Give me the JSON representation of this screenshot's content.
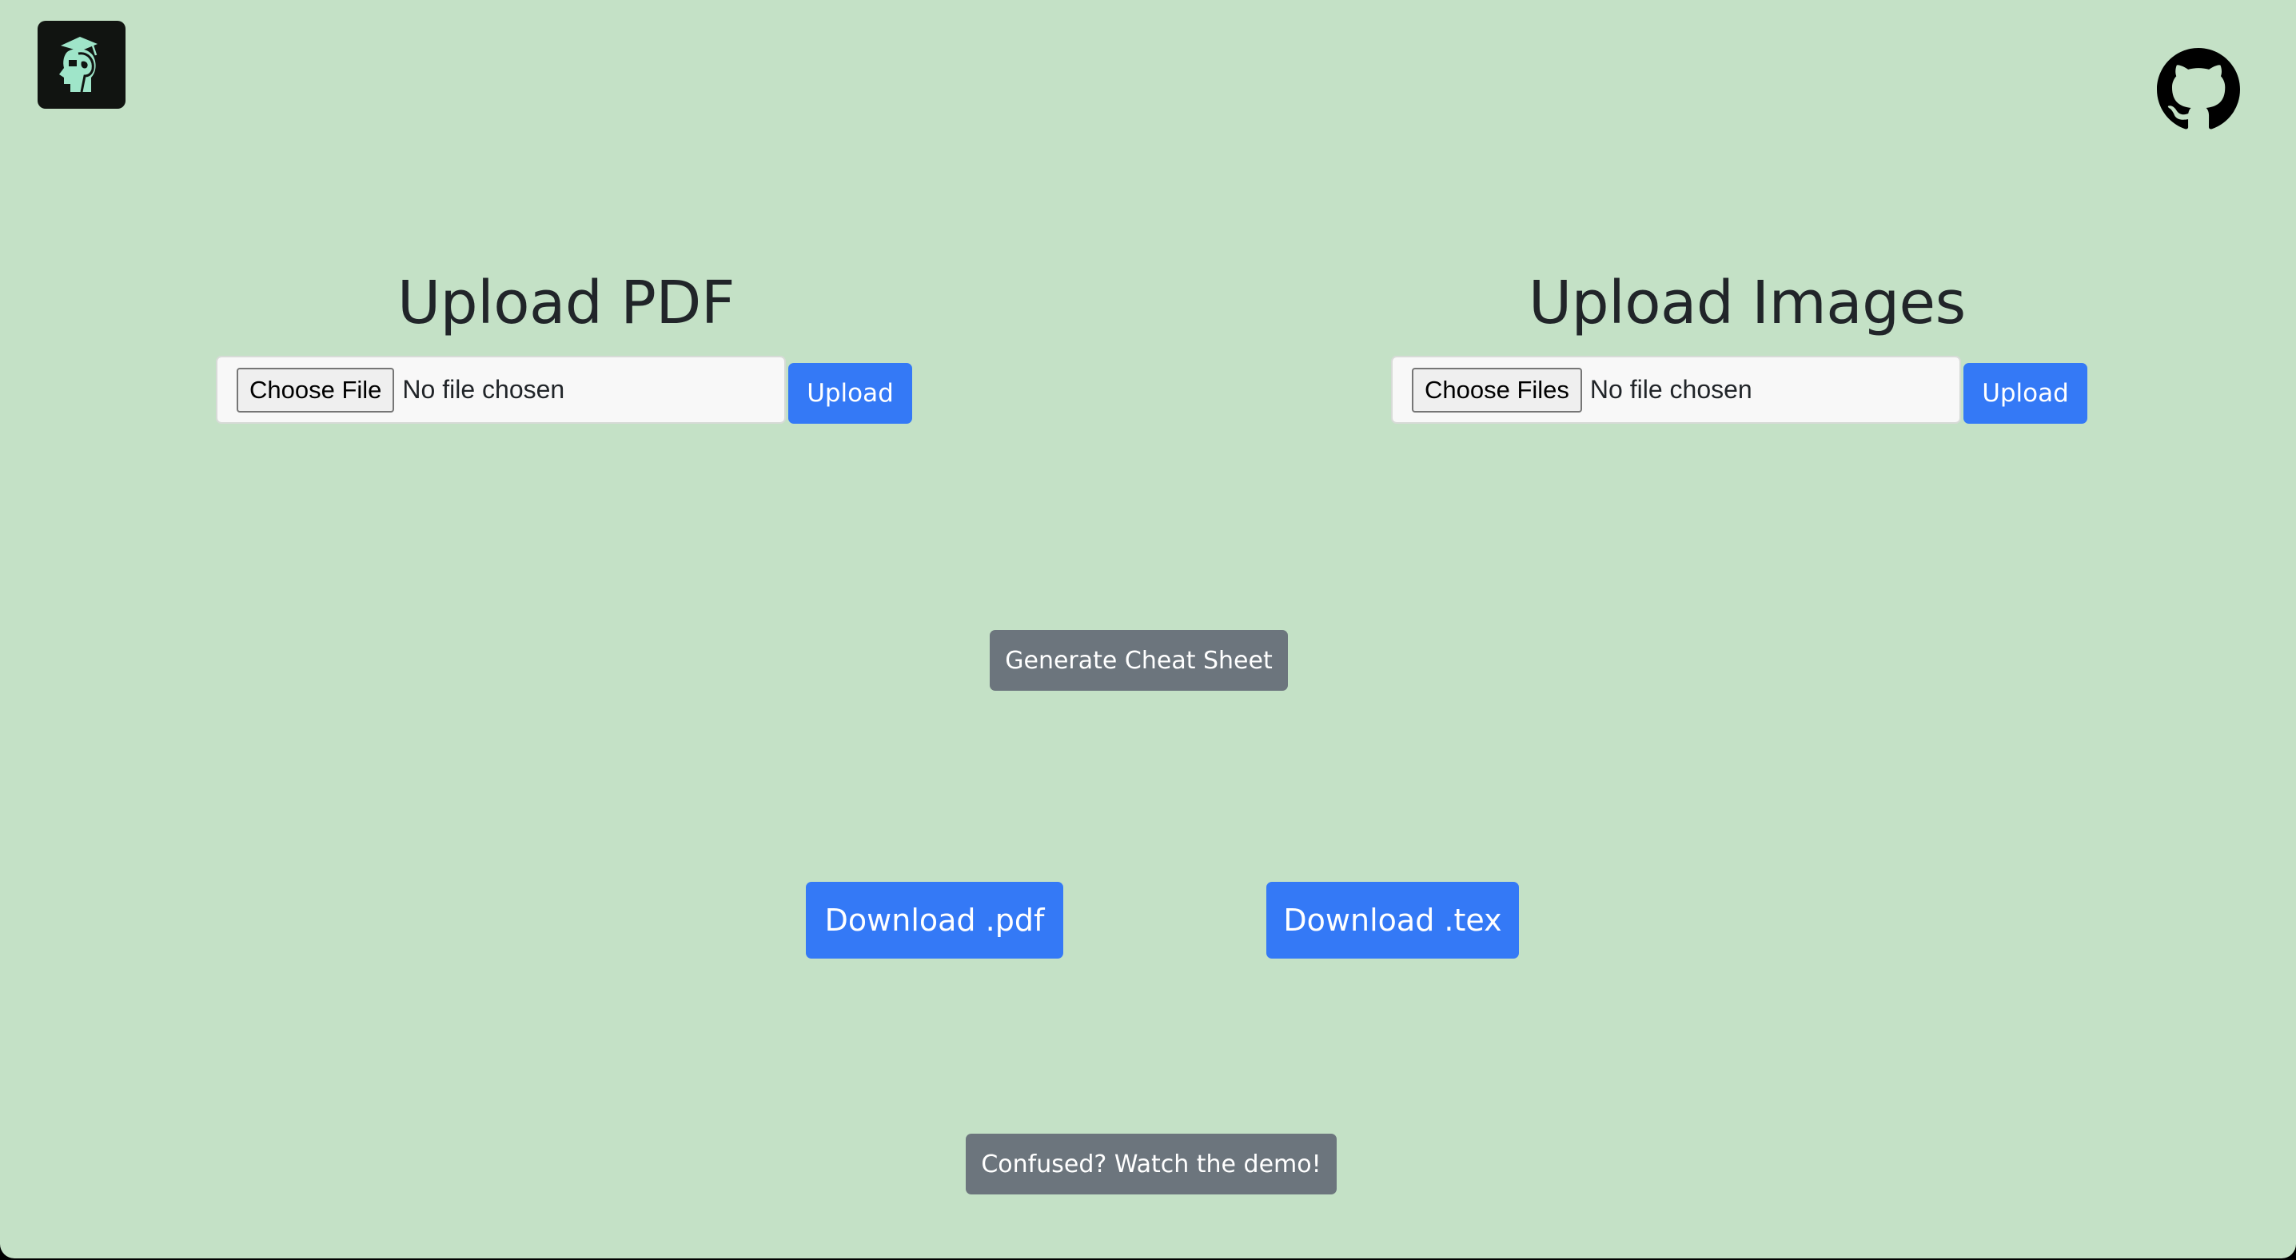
{
  "header": {
    "logo_icon": "head-with-graduation-cap-icon",
    "github_icon": "github-icon"
  },
  "pdf_section": {
    "title": "Upload PDF",
    "choose_label": "Choose File",
    "status": "No file chosen",
    "upload_label": "Upload"
  },
  "images_section": {
    "title": "Upload Images",
    "choose_label": "Choose Files",
    "status": "No file chosen",
    "upload_label": "Upload"
  },
  "actions": {
    "generate_label": "Generate Cheat Sheet",
    "download_pdf_label": "Download .pdf",
    "download_tex_label": "Download .tex",
    "demo_label": "Confused? Watch the demo!"
  },
  "colors": {
    "background": "#c4e1c6",
    "primary": "#3479f6",
    "secondary": "#6c757d",
    "logo_bg": "#111411",
    "logo_accent": "#9fe5c9"
  }
}
